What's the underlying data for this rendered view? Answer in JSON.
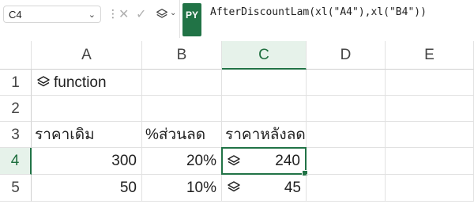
{
  "formula_bar": {
    "name_box": "C4",
    "formula": "AfterDiscountLam(xl(\"A4\"),xl(\"B4\"))",
    "py_badge": "PY"
  },
  "grid": {
    "columns": [
      "A",
      "B",
      "C",
      "D",
      "E"
    ],
    "selected_column": "C",
    "rows": [
      "1",
      "2",
      "3",
      "4",
      "5"
    ],
    "selected_row": "4",
    "cells": {
      "A1": "function",
      "A3": "ราคาเดิม",
      "B3": "%ส่วนลด",
      "C3": "ราคาหลังลด",
      "A4": "300",
      "B4": "20%",
      "C4": "240",
      "A5": "50",
      "B5": "10%",
      "C5": "45"
    },
    "active_cell": "C4"
  },
  "colors": {
    "accent": "#217346",
    "selected_header_bg": "#e6f2ea",
    "gridline": "#e1e1e1"
  },
  "icons": {
    "python_object_icon": "layers-icon",
    "cancel_icon": "close-icon",
    "enter_icon": "check-icon"
  }
}
